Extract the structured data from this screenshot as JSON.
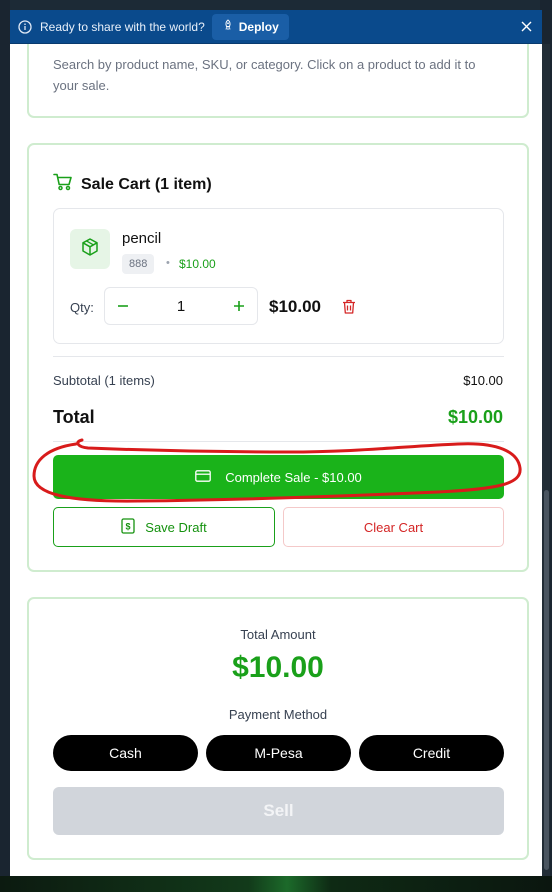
{
  "banner": {
    "text": "Ready to share with the world?",
    "deploy_label": "Deploy",
    "icons": [
      "info-icon",
      "rocket-icon",
      "close-icon"
    ]
  },
  "search": {
    "description": "Search by product name, SKU, or category. Click on a product to add it to your sale."
  },
  "cart": {
    "title": "Sale Cart (1 item)",
    "items": [
      {
        "name": "pencil",
        "sku": "888",
        "separator": "•",
        "price": "$10.00",
        "qty_label": "Qty:",
        "qty": "1",
        "line_total": "$10.00"
      }
    ],
    "subtotal_label": "Subtotal (1 items)",
    "subtotal_value": "$10.00",
    "total_label": "Total",
    "total_value": "$10.00",
    "complete_label": "Complete Sale - $10.00",
    "save_draft_label": "Save Draft",
    "clear_cart_label": "Clear Cart"
  },
  "payment": {
    "total_amount_label": "Total Amount",
    "amount": "$10.00",
    "method_label": "Payment Method",
    "methods": [
      "Cash",
      "M-Pesa",
      "Credit"
    ],
    "sell_label": "Sell"
  },
  "colors": {
    "brand_green": "#1ab31a",
    "danger_red": "#d42525",
    "banner_blue": "#0a4a8c",
    "annotation_red": "#d81b1b"
  }
}
